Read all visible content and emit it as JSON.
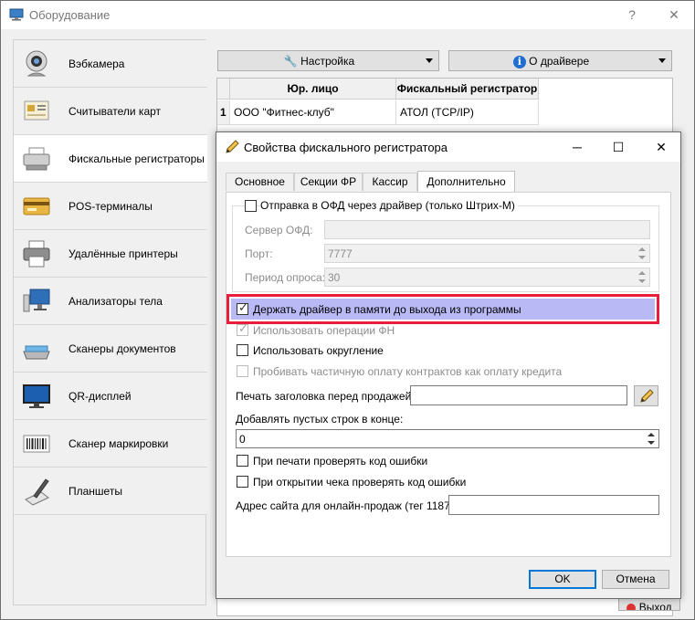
{
  "window": {
    "title": "Оборудование",
    "help_glyph": "?",
    "close_glyph": "✕"
  },
  "sidebar": {
    "items": [
      {
        "label": "Вэбкамера",
        "icon": "webcam-icon"
      },
      {
        "label": "Считыватели карт",
        "icon": "card-reader-icon"
      },
      {
        "label": "Фискальные регистраторы",
        "icon": "fiscal-printer-icon",
        "active": true
      },
      {
        "label": "POS-терминалы",
        "icon": "pos-terminal-icon"
      },
      {
        "label": "Удалённые принтеры",
        "icon": "printer-icon"
      },
      {
        "label": "Анализаторы тела",
        "icon": "body-analyzer-icon"
      },
      {
        "label": "Сканеры документов",
        "icon": "document-scanner-icon"
      },
      {
        "label": "QR-дисплей",
        "icon": "qr-display-icon"
      },
      {
        "label": "Сканер маркировки",
        "icon": "barcode-scanner-icon"
      },
      {
        "label": "Планшеты",
        "icon": "tablet-icon"
      }
    ]
  },
  "toolbar": {
    "settings_label": "Настройка",
    "about_label": "О драйвере"
  },
  "grid": {
    "columns": [
      "Юр. лицо",
      "Фискальный регистратор"
    ],
    "rows": [
      {
        "num": "1",
        "entity": "ООО \"Фитнес-клуб\"",
        "register": "АТОЛ (TCP/IP)"
      }
    ]
  },
  "dialog": {
    "title": "Свойства фискального регистратора",
    "minimize_glyph": "─",
    "maximize_glyph": "☐",
    "close_glyph": "✕",
    "tabs": [
      "Основное",
      "Секции ФР",
      "Кассир",
      "Дополнительно"
    ],
    "active_tab": "Дополнительно",
    "ofd_group": {
      "checkbox_label": "Отправка в ОФД через драйвер (только Штрих-М)",
      "checked": false,
      "server_label": "Сервер ОФД:",
      "server_value": "",
      "port_label": "Порт:",
      "port_value": "7777",
      "period_label": "Период опроса:",
      "period_value": "30"
    },
    "options": {
      "keep_driver_label": "Держать драйвер в памяти до выхода из программы",
      "keep_driver_checked": true,
      "use_fn_label": "Использовать операции ФН",
      "use_fn_checked": true,
      "rounding_label": "Использовать округление",
      "rounding_checked": false,
      "partial_payment_label": "Пробивать частичную оплату контрактов как оплату кредита",
      "partial_payment_checked": false
    },
    "header_print_label": "Печать заголовка перед продажей:",
    "header_print_value": "",
    "empty_lines_label": "Добавлять пустых строк в конце:",
    "empty_lines_value": "0",
    "check_error_print_label": "При печати проверять код ошибки",
    "check_error_print_checked": false,
    "check_error_open_label": "При открытии чека проверять код ошибки",
    "check_error_open_checked": false,
    "site_label": "Адрес сайта для онлайн-продаж (тег 1187):",
    "site_value": "",
    "ok_label": "OK",
    "cancel_label": "Отмена"
  },
  "exit_label": "Выход",
  "colors": {
    "highlight_border": "#e81e3c",
    "highlight_fill": "#b9b9f5",
    "accent": "#0078d7"
  }
}
